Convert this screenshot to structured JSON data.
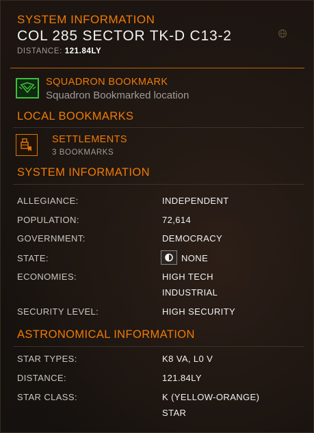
{
  "header": {
    "section_title": "SYSTEM INFORMATION",
    "system_name": "COL 285 SECTOR TK-D C13-2",
    "distance_label": "DISTANCE:",
    "distance_value": "121.84LY",
    "globe_icon": "globe-icon"
  },
  "squadron": {
    "title": "SQUADRON BOOKMARK",
    "subtitle": "Squadron Bookmarked location",
    "icon": "squadron-bookmark-icon",
    "accent": "#3fbf3a"
  },
  "local_bookmarks": {
    "heading": "LOCAL BOOKMARKS",
    "items": [
      {
        "title": "SETTLEMENTS",
        "subtitle": "3 BOOKMARKS",
        "icon": "settlement-bookmark-icon"
      }
    ]
  },
  "system_info": {
    "heading": "SYSTEM INFORMATION",
    "rows": [
      {
        "label": "ALLEGIANCE:",
        "value": "INDEPENDENT"
      },
      {
        "label": "POPULATION:",
        "value": "72,614"
      },
      {
        "label": "GOVERNMENT:",
        "value": "DEMOCRACY"
      },
      {
        "label": "STATE:",
        "value": "NONE",
        "icon": "half-circle-icon"
      },
      {
        "label": "ECONOMIES:",
        "value": "HIGH TECH",
        "value2": "INDUSTRIAL"
      },
      {
        "label": "SECURITY LEVEL:",
        "value": "HIGH SECURITY"
      }
    ]
  },
  "astronomical": {
    "heading": "ASTRONOMICAL INFORMATION",
    "rows": [
      {
        "label": "STAR TYPES:",
        "value": "K8 VA, L0 V"
      },
      {
        "label": "DISTANCE:",
        "value": "121.84LY"
      },
      {
        "label": "STAR CLASS:",
        "value": "K (YELLOW-ORANGE)",
        "value2": "STAR"
      }
    ]
  },
  "colors": {
    "accent": "#f07b05",
    "text": "#f2f2f2",
    "muted": "#a09c98",
    "background": "#1a1410"
  }
}
